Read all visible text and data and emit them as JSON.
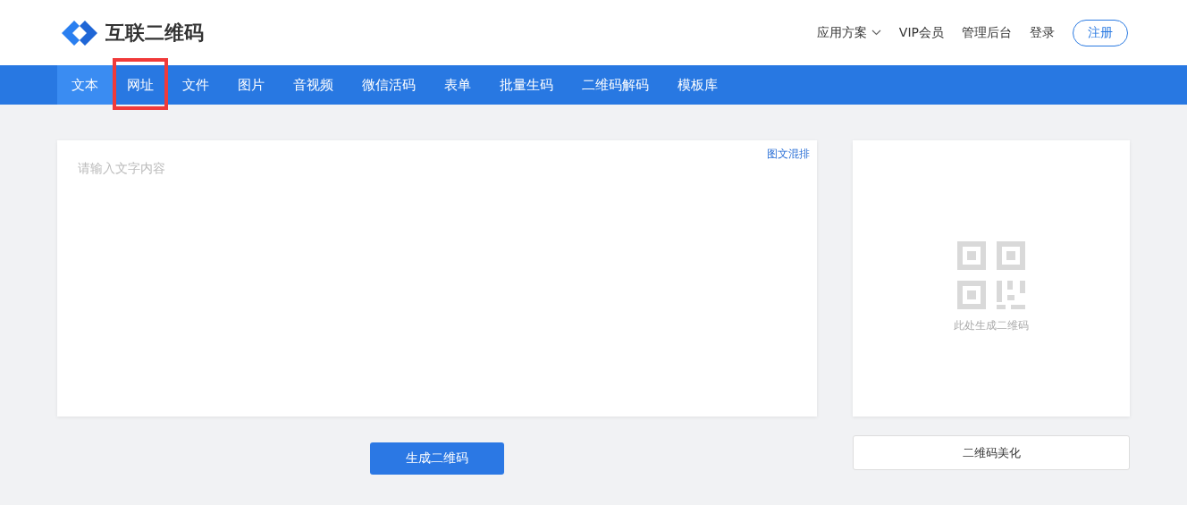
{
  "logo": {
    "text": "互联二维码"
  },
  "top_links": [
    {
      "label": "应用方案",
      "dropdown": true
    },
    {
      "label": "VIP会员",
      "dropdown": false
    },
    {
      "label": "管理后台",
      "dropdown": false
    },
    {
      "label": "登录",
      "dropdown": false
    }
  ],
  "register_button": "注册",
  "tabs": [
    {
      "label": "文本",
      "selected": true,
      "highlighted": false
    },
    {
      "label": "网址",
      "selected": false,
      "highlighted": true
    },
    {
      "label": "文件",
      "selected": false,
      "highlighted": false
    },
    {
      "label": "图片",
      "selected": false,
      "highlighted": false
    },
    {
      "label": "音视频",
      "selected": false,
      "highlighted": false
    },
    {
      "label": "微信活码",
      "selected": false,
      "highlighted": false
    },
    {
      "label": "表单",
      "selected": false,
      "highlighted": false
    },
    {
      "label": "批量生码",
      "selected": false,
      "highlighted": false
    },
    {
      "label": "二维码解码",
      "selected": false,
      "highlighted": false
    },
    {
      "label": "模板库",
      "selected": false,
      "highlighted": false
    }
  ],
  "editor": {
    "placeholder": "请输入文字内容",
    "mixed_layout_link": "图文混排"
  },
  "generate_button": "生成二维码",
  "preview": {
    "hint": "此处生成二维码"
  },
  "beautify_button": "二维码美化"
}
